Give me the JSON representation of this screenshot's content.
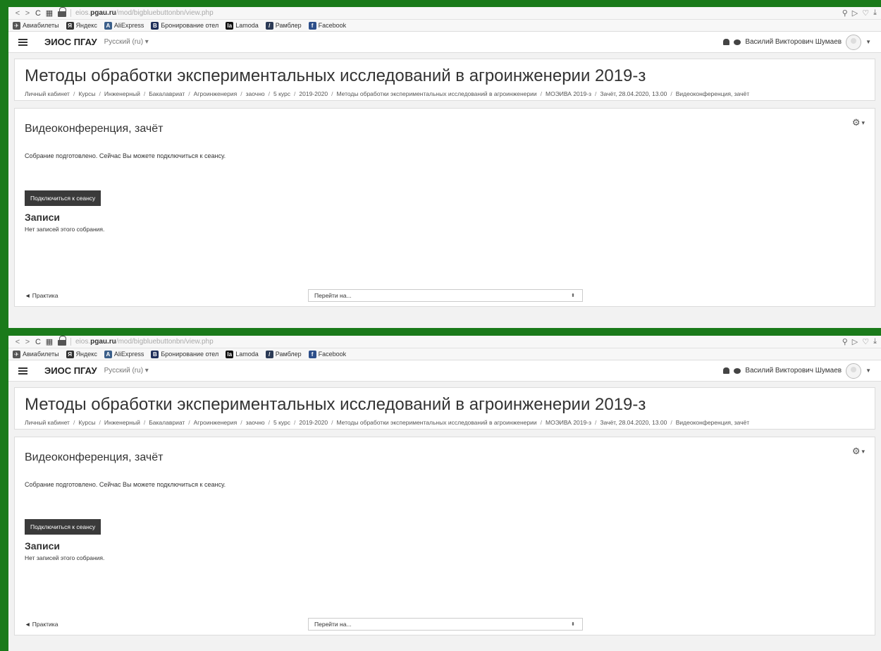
{
  "browser": {
    "url_host_prefix": "eios.",
    "url_host_bold": "pgau.ru",
    "url_path": "/mod/bigbluebuttonbn/view.php",
    "back_icon": "chevron-left-icon",
    "forward_icon": "chevron-right-icon",
    "reload_icon": "reload-icon",
    "grid_icon": "grid-icon"
  },
  "bookmarks": [
    {
      "label": "Авиабилеты",
      "icon": "plane-icon",
      "glyph": "✈",
      "color": "#555555"
    },
    {
      "label": "Яндекс",
      "icon": "yandex-icon",
      "glyph": "Я",
      "color": "#333333"
    },
    {
      "label": "AliExpress",
      "icon": "aliexpress-icon",
      "glyph": "A",
      "color": "#3b5f8a"
    },
    {
      "label": "Бронирование отел",
      "icon": "booking-icon",
      "glyph": "B",
      "color": "#1f2f5a"
    },
    {
      "label": "Lamoda",
      "icon": "lamoda-icon",
      "glyph": "la",
      "color": "#111111"
    },
    {
      "label": "Рамблер",
      "icon": "rambler-icon",
      "glyph": "/",
      "color": "#2b3a55"
    },
    {
      "label": "Facebook",
      "icon": "facebook-icon",
      "glyph": "f",
      "color": "#2d4f8a"
    }
  ],
  "navbar": {
    "site_name": "ЭИОС ПГАУ",
    "language": "Русский (ru) ▾",
    "user_name": "Василий Викторович Шумаев"
  },
  "page": {
    "course_title": "Методы обработки экспериментальных исследований в агроинженерии 2019-з",
    "breadcrumb": [
      "Личный кабинет",
      "Курсы",
      "Инженерный",
      "Бакалавриат",
      "Агроинженерия",
      "заочно",
      "5 курс",
      "2019-2020",
      "Методы обработки экспериментальных исследований в агроинженерии",
      "МОЭИВА 2019-з",
      "Зачёт, 28.04.2020, 13.00",
      "Видеоконференция, зачёт"
    ],
    "activity_title": "Видеоконференция, зачёт",
    "status_text": "Собрание подготовлено. Сейчас Вы можете подключиться к сеансу.",
    "join_button": "Подключиться к сеансу",
    "recordings_title": "Записи",
    "recordings_empty": "Нет записей этого собрания.",
    "prev_activity": "◄ Практика",
    "jump_to": "Перейти на...",
    "jump_arrow": "⬍"
  }
}
